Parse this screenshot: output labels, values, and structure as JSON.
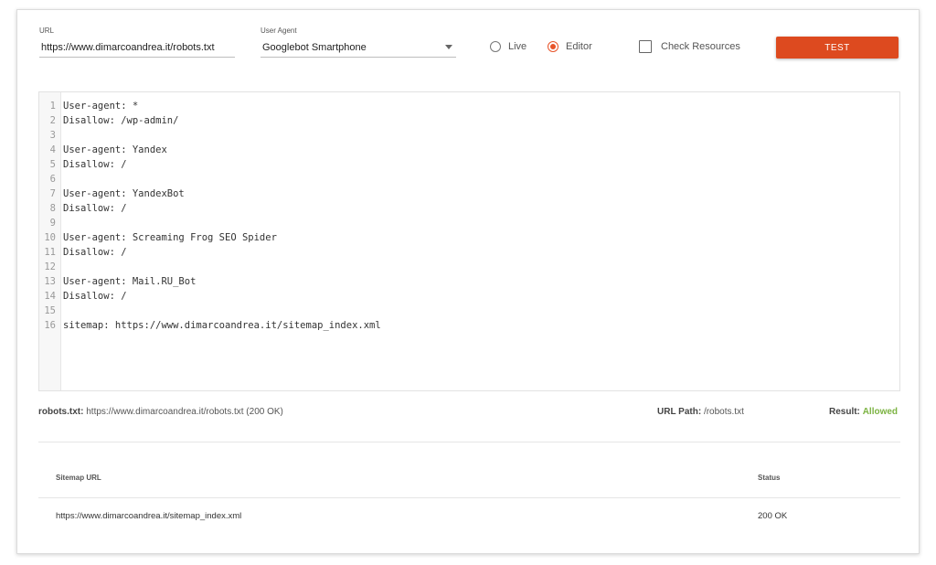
{
  "form": {
    "url_label": "URL",
    "url_value": "https://www.dimarcoandrea.it/robots.txt",
    "user_agent_label": "User Agent",
    "user_agent_value": "Googlebot Smartphone",
    "mode_live": "Live",
    "mode_editor": "Editor",
    "mode_selected": "Editor",
    "check_resources": "Check Resources",
    "check_resources_checked": false,
    "test_button": "TEST"
  },
  "editor": {
    "lines": [
      {
        "n": "1",
        "text": "User-agent: *"
      },
      {
        "n": "2",
        "text": "Disallow: /wp-admin/"
      },
      {
        "n": "3",
        "text": ""
      },
      {
        "n": "4",
        "text": "User-agent: Yandex"
      },
      {
        "n": "5",
        "text": "Disallow: /"
      },
      {
        "n": "6",
        "text": ""
      },
      {
        "n": "7",
        "text": "User-agent: YandexBot"
      },
      {
        "n": "8",
        "text": "Disallow: /"
      },
      {
        "n": "9",
        "text": ""
      },
      {
        "n": "10",
        "text": "User-agent: Screaming Frog SEO Spider"
      },
      {
        "n": "11",
        "text": "Disallow: /"
      },
      {
        "n": "12",
        "text": ""
      },
      {
        "n": "13",
        "text": "User-agent: Mail.RU_Bot"
      },
      {
        "n": "14",
        "text": "Disallow: /"
      },
      {
        "n": "15",
        "text": ""
      },
      {
        "n": "16",
        "text": "sitemap: https://www.dimarcoandrea.it/sitemap_index.xml"
      }
    ]
  },
  "result": {
    "robots_label": "robots.txt:",
    "robots_value": "https://www.dimarcoandrea.it/robots.txt (200 OK)",
    "path_label": "URL Path:",
    "path_value": "/robots.txt",
    "result_label": "Result:",
    "result_value": "Allowed",
    "result_color": "#7cb342"
  },
  "sitemaps": {
    "col_url": "Sitemap URL",
    "col_status": "Status",
    "rows": [
      {
        "url": "https://www.dimarcoandrea.it/sitemap_index.xml",
        "status": "200 OK"
      }
    ]
  },
  "colors": {
    "accent": "#dd4a1f",
    "radio_selected": "#e8542a"
  }
}
